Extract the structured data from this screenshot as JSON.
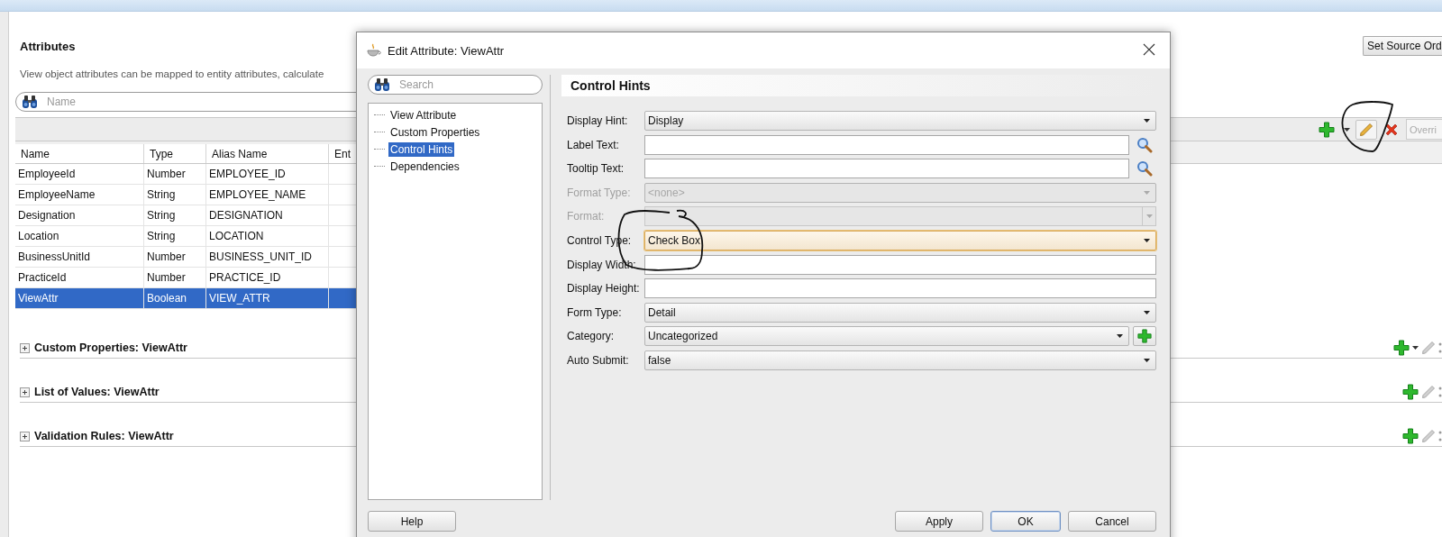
{
  "page": {
    "title": "Attributes",
    "description": "View object attributes can be mapped to entity attributes, calculate",
    "set_source_order_button": "Set Source Ord",
    "search": {
      "placeholder": "Name"
    },
    "toolbar": {
      "filter": {
        "placeholder": "Overri"
      }
    }
  },
  "table": {
    "columns": [
      "Name",
      "Type",
      "Alias Name",
      "Ent"
    ],
    "rows": [
      {
        "cells": [
          "EmployeeId",
          "Number",
          "EMPLOYEE_ID"
        ],
        "selected": false
      },
      {
        "cells": [
          "EmployeeName",
          "String",
          "EMPLOYEE_NAME"
        ],
        "selected": false
      },
      {
        "cells": [
          "Designation",
          "String",
          "DESIGNATION"
        ],
        "selected": false
      },
      {
        "cells": [
          "Location",
          "String",
          "LOCATION"
        ],
        "selected": false
      },
      {
        "cells": [
          "BusinessUnitId",
          "Number",
          "BUSINESS_UNIT_ID"
        ],
        "selected": false
      },
      {
        "cells": [
          "PracticeId",
          "Number",
          "PRACTICE_ID"
        ],
        "selected": false
      },
      {
        "cells": [
          "ViewAttr",
          "Boolean",
          "VIEW_ATTR"
        ],
        "selected": true
      }
    ]
  },
  "sections": [
    {
      "title": "Custom Properties: ViewAttr",
      "expanded": false,
      "add_menu": true
    },
    {
      "title": "List of Values: ViewAttr",
      "expanded": false,
      "add_menu": false
    },
    {
      "title": "Validation Rules: ViewAttr",
      "expanded": false,
      "add_menu": false
    }
  ],
  "dialog": {
    "title": "Edit Attribute: ViewAttr",
    "search": {
      "placeholder": "Search"
    },
    "tree": [
      {
        "label": "View Attribute",
        "selected": false
      },
      {
        "label": "Custom Properties",
        "selected": false
      },
      {
        "label": "Control Hints",
        "selected": true
      },
      {
        "label": "Dependencies",
        "selected": false
      }
    ],
    "panel_title": "Control Hints",
    "fields": [
      {
        "label": "Display Hint:",
        "kind": "select",
        "value": "Display",
        "disabled": false,
        "focused": false
      },
      {
        "label": "Label Text:",
        "kind": "lookup",
        "disabled": false,
        "focused": false
      },
      {
        "label": "Tooltip Text:",
        "kind": "lookup",
        "disabled": false,
        "focused": false
      },
      {
        "label": "Format Type:",
        "kind": "select",
        "value": "<none>",
        "disabled": true,
        "focused": false
      },
      {
        "label": "Format:",
        "kind": "combo",
        "disabled": true,
        "focused": false
      },
      {
        "label": "Control Type:",
        "kind": "select",
        "value": "Check Box",
        "disabled": false,
        "focused": true
      },
      {
        "label": "Display Width:",
        "kind": "text",
        "disabled": false,
        "focused": false
      },
      {
        "label": "Display Height:",
        "kind": "text",
        "disabled": false,
        "focused": false
      },
      {
        "label": "Form Type:",
        "kind": "select",
        "value": "Detail",
        "disabled": false,
        "focused": false
      },
      {
        "label": "Category:",
        "kind": "select_add",
        "value": "Uncategorized",
        "disabled": false,
        "focused": false
      },
      {
        "label": "Auto Submit:",
        "kind": "select",
        "value": "false",
        "disabled": false,
        "focused": false
      }
    ],
    "help_button": "Help",
    "buttons": [
      {
        "label": "Apply",
        "default": false
      },
      {
        "label": "OK",
        "default": true
      },
      {
        "label": "Cancel",
        "default": false
      }
    ]
  }
}
